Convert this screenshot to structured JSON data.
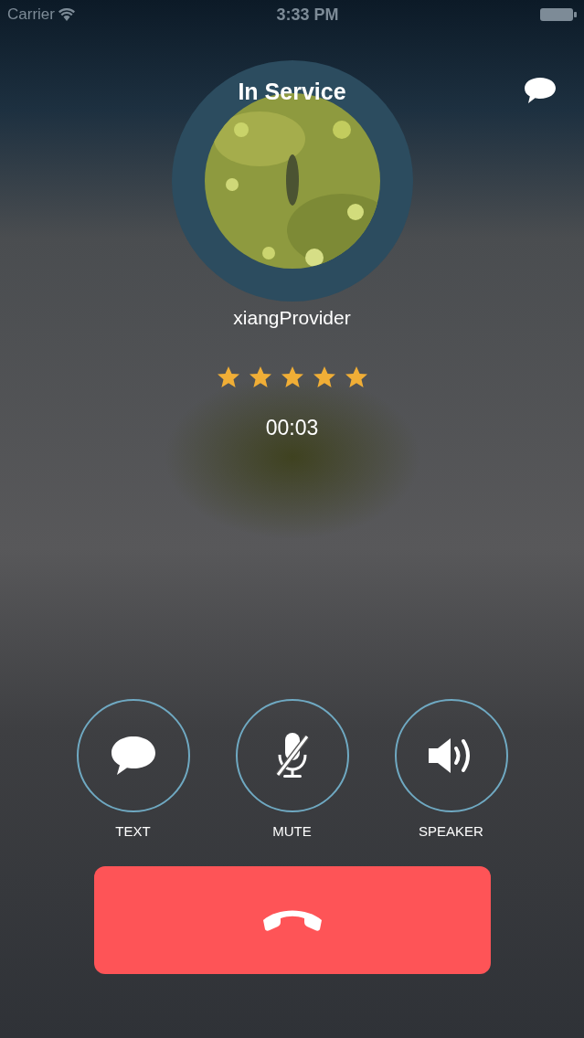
{
  "status_bar": {
    "carrier": "Carrier",
    "time": "3:33 PM"
  },
  "header": {
    "title": "In Service"
  },
  "caller": {
    "name": "xiangProvider",
    "stars": 5,
    "duration": "00:03"
  },
  "actions": [
    {
      "kind": "text",
      "label": "TEXT"
    },
    {
      "kind": "mute",
      "label": "MUTE"
    },
    {
      "kind": "speaker",
      "label": "SPEAKER"
    }
  ],
  "end_call": {
    "kind": "hangup"
  }
}
